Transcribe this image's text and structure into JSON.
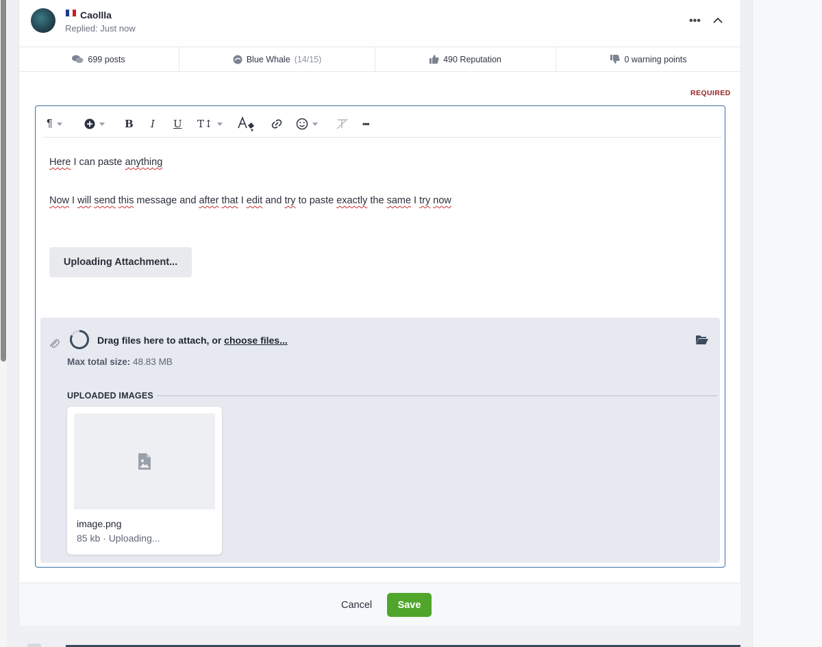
{
  "post": {
    "username": "Caollla",
    "replied": "Replied: Just now",
    "flag_colors": [
      "#1e3a8f",
      "#ffffff",
      "#d01c1f"
    ],
    "more_label": "•••"
  },
  "stats": {
    "posts": "699 posts",
    "rank": "Blue Whale",
    "rank_progress": "(14/15)",
    "reputation": "490 Reputation",
    "warnings": "0 warning points"
  },
  "editor": {
    "required_label": "REQUIRED",
    "toolbar": {
      "paragraph": "¶",
      "bold": "B",
      "italic": "I",
      "underline": "U",
      "text_size": "T↕",
      "more": "•••"
    },
    "lines": {
      "line1": [
        "Here",
        " I can paste ",
        "anything"
      ],
      "line2": [
        "Now",
        " I ",
        "will",
        " ",
        "send",
        " ",
        "this",
        " message and ",
        "after",
        " ",
        "that",
        " I ",
        "edit",
        " and ",
        "try",
        " to paste ",
        "exactly",
        " the ",
        "same",
        " I ",
        "try",
        " ",
        "now"
      ]
    },
    "uploading_button": "Uploading Attachment..."
  },
  "attachments": {
    "drag_text": "Drag files here to attach, or ",
    "choose_link": "choose files...",
    "max_label": "Max total size:",
    "max_value": " 48.83 MB",
    "uploaded_title": "UPLOADED IMAGES",
    "files": [
      {
        "name": "image.png",
        "meta": "85 kb · Uploading..."
      }
    ]
  },
  "footer": {
    "cancel": "Cancel",
    "save": "Save"
  },
  "colors": {
    "accent_border": "#3a6ea5",
    "save_green": "#4fa62a",
    "required_red": "#9a2020"
  }
}
